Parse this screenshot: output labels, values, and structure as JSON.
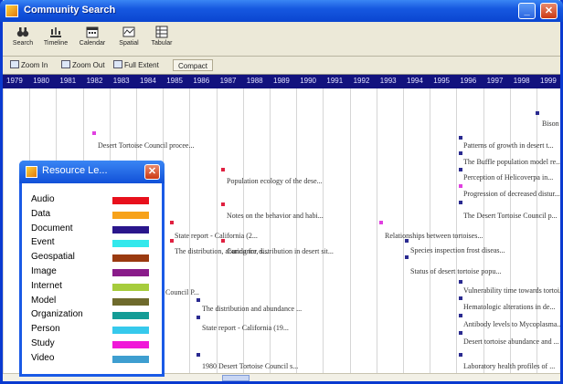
{
  "window": {
    "title": "Community Search"
  },
  "toolbar": [
    {
      "label": "Search",
      "icon": "binoculars-icon"
    },
    {
      "label": "Timeline",
      "icon": "timeline-icon"
    },
    {
      "label": "Calendar",
      "icon": "calendar-icon"
    },
    {
      "label": "Spatial",
      "icon": "map-icon"
    },
    {
      "label": "Tabular",
      "icon": "table-icon"
    }
  ],
  "toolbar2": [
    {
      "label": "Zoom In",
      "icon": "zoom-in-icon"
    },
    {
      "label": "Zoom Out",
      "icon": "zoom-out-icon"
    },
    {
      "label": "Full Extent",
      "icon": "full-extent-icon"
    },
    {
      "label": "Compact",
      "icon": ""
    }
  ],
  "years": [
    "1979",
    "1980",
    "1981",
    "1982",
    "1983",
    "1984",
    "1985",
    "1986",
    "1987",
    "1988",
    "1989",
    "1990",
    "1991",
    "1992",
    "1993",
    "1994",
    "1995",
    "1996",
    "1997",
    "1998",
    "1999"
  ],
  "events": [
    {
      "text": "Bison re...",
      "color": "#2a2a90"
    },
    {
      "text": "Desert Tortoise Council procee...",
      "color": "#e040e0"
    },
    {
      "text": "Patterns of growth in desert t...",
      "color": "#2a2a90"
    },
    {
      "text": "The Buffle population model re...",
      "color": "#2a2a90"
    },
    {
      "text": "Population ecology of the dese...",
      "color": "#e02040"
    },
    {
      "text": "Perception of Helicoverpa in...",
      "color": "#2a2a90"
    },
    {
      "text": "Progression of decreased distur...",
      "color": "#e040e0"
    },
    {
      "text": "Notes on the behavior and habi...",
      "color": "#e02040"
    },
    {
      "text": "The Desert Tortoise Council p...",
      "color": "#2a2a90"
    },
    {
      "text": "State report - California (2...",
      "color": "#e02040"
    },
    {
      "text": "Relationships between tortoises...",
      "color": "#e040e0"
    },
    {
      "text": "The distribution, abundance, s...",
      "color": "#e02040"
    },
    {
      "text": "Caring for distribution in desert sit...",
      "color": "#e02040"
    },
    {
      "text": "Species inspection frost diseas...",
      "color": "#2a2a90"
    },
    {
      "text": "Status of desert tortoise popu...",
      "color": "#2a2a90"
    },
    {
      "text": "Council P...",
      "color": "#2a2a90"
    },
    {
      "text": "Vulnerability time towards tortoi...",
      "color": "#2a2a90"
    },
    {
      "text": "The distribution and abundance ...",
      "color": "#2a2a90"
    },
    {
      "text": "Hematologic alterations in de...",
      "color": "#2a2a90"
    },
    {
      "text": "State report - California (19...",
      "color": "#2a2a90"
    },
    {
      "text": "Antibody levels to Mycoplasma...",
      "color": "#2a2a90"
    },
    {
      "text": "Desert tortoise abundance and ...",
      "color": "#2a2a90"
    },
    {
      "text": "1980 Desert Tortoise Council s...",
      "color": "#2a2a90"
    },
    {
      "text": "Laboratory health profiles of ...",
      "color": "#2a2a90"
    }
  ],
  "legend": {
    "title": "Resource Le...",
    "items": [
      {
        "name": "Audio",
        "color": "#e8101c"
      },
      {
        "name": "Data",
        "color": "#f7a21a"
      },
      {
        "name": "Document",
        "color": "#2a168c"
      },
      {
        "name": "Event",
        "color": "#33e8ec"
      },
      {
        "name": "Geospatial",
        "color": "#9a3a10"
      },
      {
        "name": "Image",
        "color": "#8a1c8a"
      },
      {
        "name": "Internet",
        "color": "#a6cc3c"
      },
      {
        "name": "Model",
        "color": "#6e6a2c"
      },
      {
        "name": "Organization",
        "color": "#139c96"
      },
      {
        "name": "Person",
        "color": "#36c9ec"
      },
      {
        "name": "Study",
        "color": "#f018d8"
      },
      {
        "name": "Video",
        "color": "#3e9ed0"
      }
    ]
  }
}
